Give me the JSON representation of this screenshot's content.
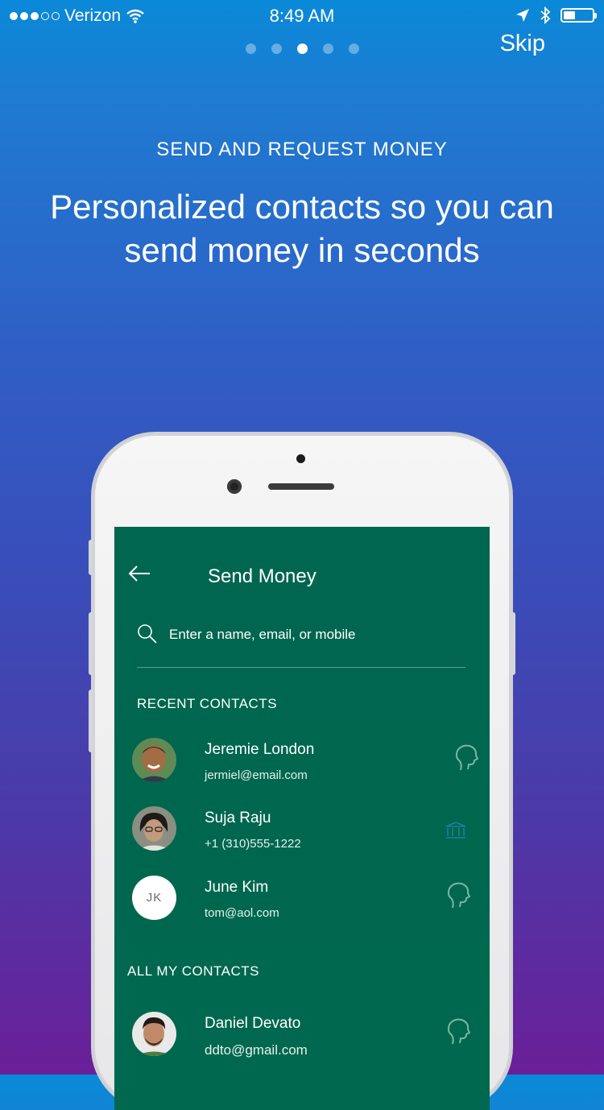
{
  "status_bar": {
    "carrier": "Verizon",
    "time": "8:49 AM"
  },
  "onboarding": {
    "skip_label": "Skip",
    "eyebrow": "SEND AND REQUEST MONEY",
    "headline": "Personalized contacts so you can send money in seconds",
    "page_count": 5,
    "active_page": 3
  },
  "screen": {
    "title": "Send Money",
    "search_placeholder": "Enter a name, email, or mobile",
    "recent_header": "RECENT CONTACTS",
    "all_header": "ALL MY CONTACTS",
    "recent_contacts": [
      {
        "name": "Jeremie London",
        "detail": "jermiel@email.com",
        "icon": "paypal-head-icon"
      },
      {
        "name": "Suja Raju",
        "detail": "+1 (310)555-1222",
        "icon": "bank-icon"
      },
      {
        "name": "June Kim",
        "detail": "tom@aol.com",
        "initials": "JK",
        "icon": "paypal-head-icon"
      }
    ],
    "all_contacts": [
      {
        "name": "Daniel Devato",
        "detail": "ddto@gmail.com",
        "icon": "paypal-head-icon"
      }
    ]
  },
  "colors": {
    "screen_bg": "#006650",
    "gradient_top": "#0a89d8",
    "gradient_bottom": "#6a1f98"
  }
}
